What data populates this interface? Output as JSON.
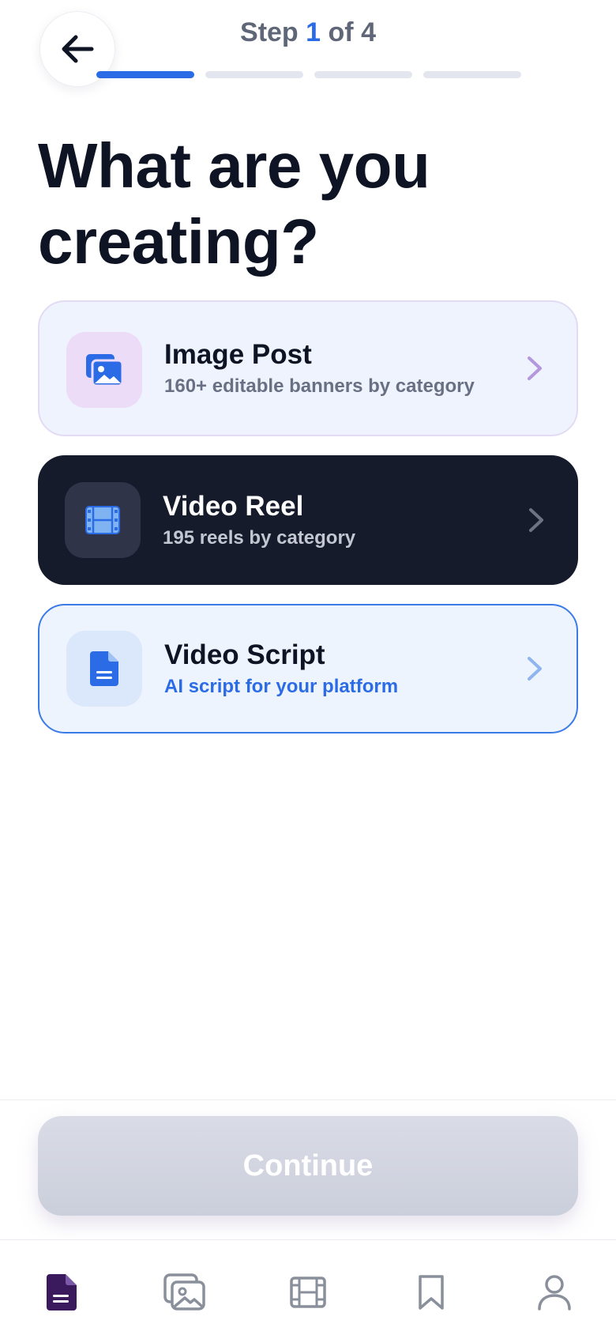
{
  "header": {
    "back_icon": "arrow-left-icon",
    "step_prefix": "Step",
    "step_current": "1",
    "step_suffix": "of 4",
    "steps_total": 4,
    "steps_completed": 1
  },
  "headline": "What are you creating?",
  "options": [
    {
      "title": "Image Post",
      "subtitle": "160+ editable banners by category",
      "icon": "images-icon"
    },
    {
      "title": "Video Reel",
      "subtitle": "195 reels by category",
      "icon": "film-icon"
    },
    {
      "title": "Video Script",
      "subtitle": "AI script for your platform",
      "icon": "document-icon",
      "selected": true
    }
  ],
  "continue_label": "Continue",
  "tabbar": {
    "items": [
      "document-icon",
      "image-icon",
      "film-icon",
      "bookmark-icon",
      "user-icon"
    ],
    "active": "document-icon"
  },
  "colors": {
    "accent": "#2b6ce6",
    "dark_card": "#161b2b",
    "active_tab": "#3a1a5c",
    "inactive_tab": "#8a8f9c"
  }
}
